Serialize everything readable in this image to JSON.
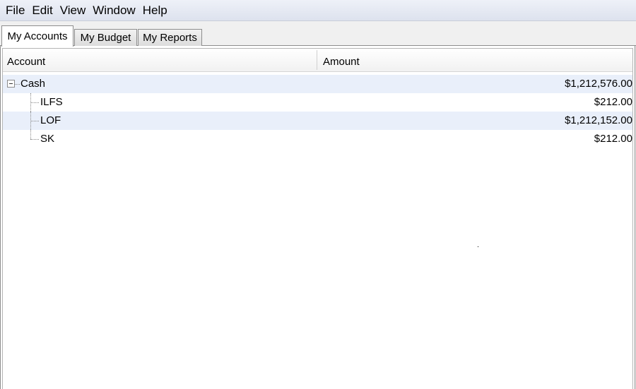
{
  "menubar": {
    "items": [
      "File",
      "Edit",
      "View",
      "Window",
      "Help"
    ]
  },
  "tabs": [
    {
      "label": "My Accounts",
      "active": true
    },
    {
      "label": "My Budget",
      "active": false
    },
    {
      "label": "My Reports",
      "active": false
    }
  ],
  "table": {
    "columns": [
      "Account",
      "Amount"
    ],
    "rows": [
      {
        "account": "Cash",
        "amount": "$1,212,576.00",
        "level": 0,
        "expanded": true
      },
      {
        "account": "ILFS",
        "amount": "$212.00",
        "level": 1
      },
      {
        "account": "LOF",
        "amount": "$1,212,152.00",
        "level": 1
      },
      {
        "account": "SK",
        "amount": "$212.00",
        "level": 1
      }
    ]
  },
  "icons": {
    "expander": "collapse-minus-icon"
  },
  "colors": {
    "row_alt": "#e9effa",
    "menubar": "#e4e8f2",
    "border": "#8d8d8d"
  }
}
